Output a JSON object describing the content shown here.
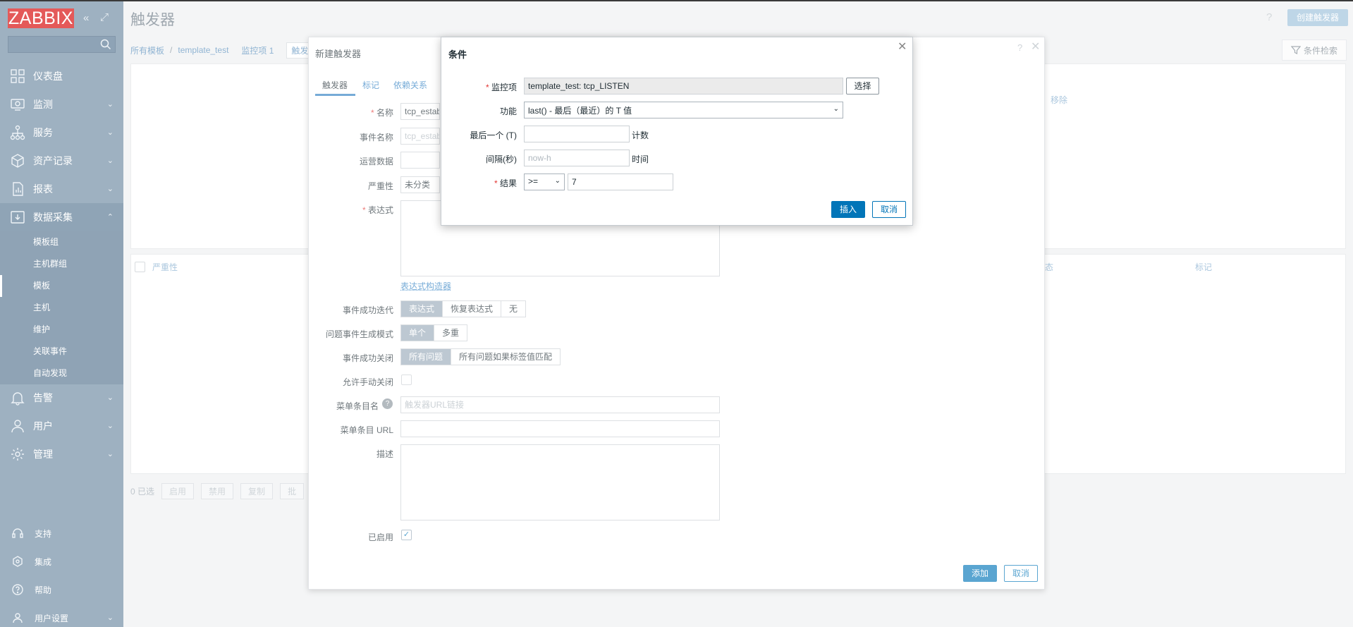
{
  "app": {
    "logo": "ZABBIX",
    "page_title": "触发器",
    "create_button": "创建触发器",
    "help_q": "?",
    "filter_label": "条件检索"
  },
  "sidebar": {
    "search_placeholder": "",
    "collapse": "«",
    "kiosk": "⤢",
    "items": [
      {
        "label": "仪表盘",
        "icon": "dashboard-icon"
      },
      {
        "label": "监测",
        "icon": "monitoring-icon"
      },
      {
        "label": "服务",
        "icon": "services-icon"
      },
      {
        "label": "资产记录",
        "icon": "inventory-icon"
      },
      {
        "label": "报表",
        "icon": "reports-icon"
      },
      {
        "label": "数据采集",
        "icon": "data-collection-icon"
      }
    ],
    "subitems": [
      "模板组",
      "主机群组",
      "模板",
      "主机",
      "维护",
      "关联事件",
      "自动发现"
    ],
    "items2": [
      {
        "label": "告警",
        "icon": "alerts-icon"
      },
      {
        "label": "用户",
        "icon": "users-icon"
      },
      {
        "label": "管理",
        "icon": "admin-icon"
      }
    ],
    "bottom": [
      {
        "label": "支持",
        "icon": "support-icon"
      },
      {
        "label": "集成",
        "icon": "integrations-icon"
      },
      {
        "label": "帮助",
        "icon": "help-icon"
      },
      {
        "label": "用户设置",
        "icon": "user-settings-icon"
      }
    ]
  },
  "breadcrumb": {
    "all": "所有模板",
    "sep": "/",
    "template": "template_test",
    "items": "监控项 1",
    "triggers": "触发"
  },
  "list": {
    "severity": "严重性",
    "status": "态",
    "tags": "标记",
    "remove": "移除"
  },
  "bottombar": {
    "selected": "0 已选",
    "enable": "启用",
    "disable": "禁用",
    "copy": "复制",
    "batch": "批"
  },
  "trigger_dialog": {
    "title": "新建触发器",
    "help": "?",
    "close": "✕",
    "tabs": [
      "触发器",
      "标记",
      "依赖关系"
    ],
    "labels": {
      "name": "名称",
      "event_name": "事件名称",
      "opdata": "运营数据",
      "severity": "严重性",
      "expression": "表达式",
      "ok_event_gen": "事件成功迭代",
      "problem_mode": "问题事件生成模式",
      "ok_close": "事件成功关闭",
      "manual_close": "允许手动关闭",
      "menu_name": "菜单条目名",
      "menu_url": "菜单条目 URL",
      "description": "描述",
      "enabled": "已启用"
    },
    "values": {
      "name": "tcp_estab",
      "event_name_ph": "tcp_estab",
      "severity": "未分类",
      "menu_name_ph": "触发器URL链接",
      "expression_builder": "表达式构造器"
    },
    "ok_event_options": [
      "表达式",
      "恢复表达式",
      "无"
    ],
    "problem_mode_options": [
      "单个",
      "多重"
    ],
    "ok_close_options": [
      "所有问题",
      "所有问题如果标签值匹配"
    ],
    "add": "添加",
    "cancel": "取消"
  },
  "condition_dialog": {
    "title": "条件",
    "close": "✕",
    "labels": {
      "item": "监控项",
      "function": "功能",
      "last_of": "最后一个 (T)",
      "shift": "间隔(秒)",
      "result": "结果"
    },
    "item_value": "template_test: tcp_LISTEN",
    "select": "选择",
    "function_value": "last() - 最后（最近）的 T 值",
    "last_of_value": "",
    "count_label": "计数",
    "shift_placeholder": "now-h",
    "time_label": "时间",
    "operator": ">=",
    "result_value": "7",
    "insert": "插入",
    "cancel": "取消"
  }
}
